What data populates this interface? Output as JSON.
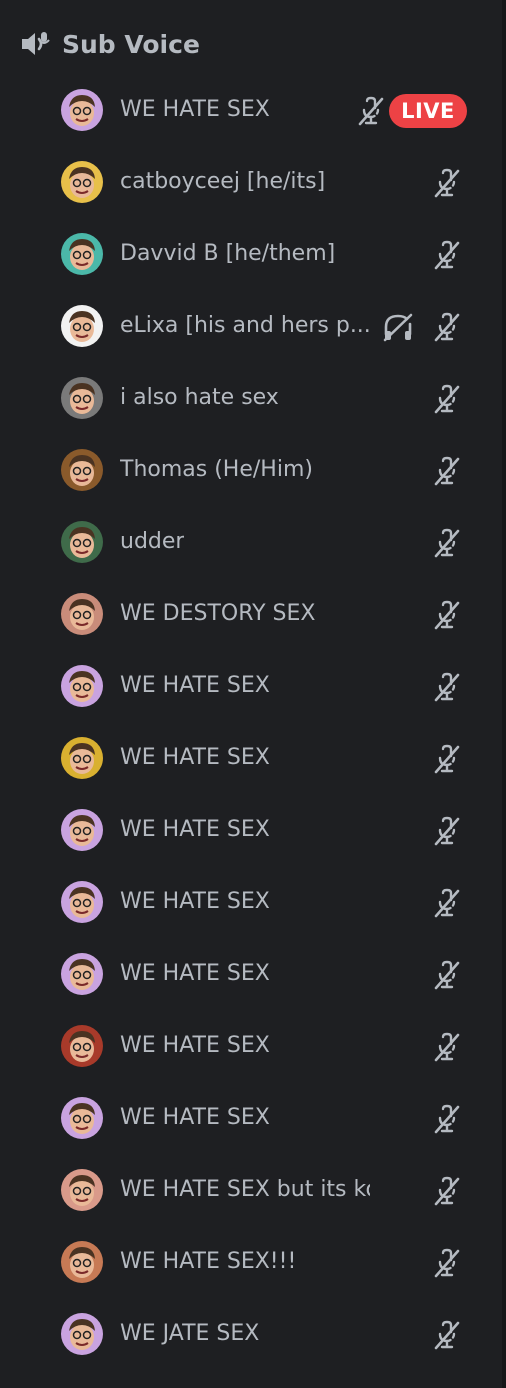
{
  "channel": {
    "name": "Sub Voice",
    "icon": "speaker-icon"
  },
  "colors": {
    "background": "#1e1f22",
    "text": "#b5bac1",
    "live": "#ed4245"
  },
  "users": [
    {
      "name": "WE HATE SEX",
      "avatar": "#c9a3e0",
      "muted": true,
      "live": true,
      "live_label": "LIVE"
    },
    {
      "name": "catboyceej [he/its]",
      "avatar": "#e8c04a",
      "muted": true
    },
    {
      "name": "Davvid B [he/them]",
      "avatar": "#4bb8a9",
      "muted": true
    },
    {
      "name": "eLixa [his and hers p...",
      "avatar": "#f2f2f2",
      "muted": true,
      "deafened": true
    },
    {
      "name": "i also hate sex",
      "avatar": "#7a7a7a",
      "muted": true
    },
    {
      "name": "Thomas (He/Him)",
      "avatar": "#8a5a2b",
      "muted": true
    },
    {
      "name": "udder",
      "avatar": "#3f6b4a",
      "muted": true
    },
    {
      "name": "WE DESTORY SEX",
      "avatar": "#c98c7a",
      "muted": true
    },
    {
      "name": "WE HATE SEX",
      "avatar": "#c9a3e0",
      "muted": true
    },
    {
      "name": "WE HATE SEX",
      "avatar": "#d9b030",
      "muted": true
    },
    {
      "name": "WE HATE SEX",
      "avatar": "#c9a3e0",
      "muted": true
    },
    {
      "name": "WE HATE SEX",
      "avatar": "#c9a3e0",
      "muted": true
    },
    {
      "name": "WE HATE SEX",
      "avatar": "#c9a3e0",
      "muted": true
    },
    {
      "name": "WE HATE SEX",
      "avatar": "#a83a2a",
      "muted": true
    },
    {
      "name": "WE HATE SEX",
      "avatar": "#c9a3e0",
      "muted": true
    },
    {
      "name": "WE HATE SEX but its kou",
      "avatar": "#d99a8a",
      "muted": true
    },
    {
      "name": "WE HATE SEX!!!",
      "avatar": "#c77a55",
      "muted": true
    },
    {
      "name": "WE JATE SEX",
      "avatar": "#c9a3e0",
      "muted": true
    }
  ]
}
